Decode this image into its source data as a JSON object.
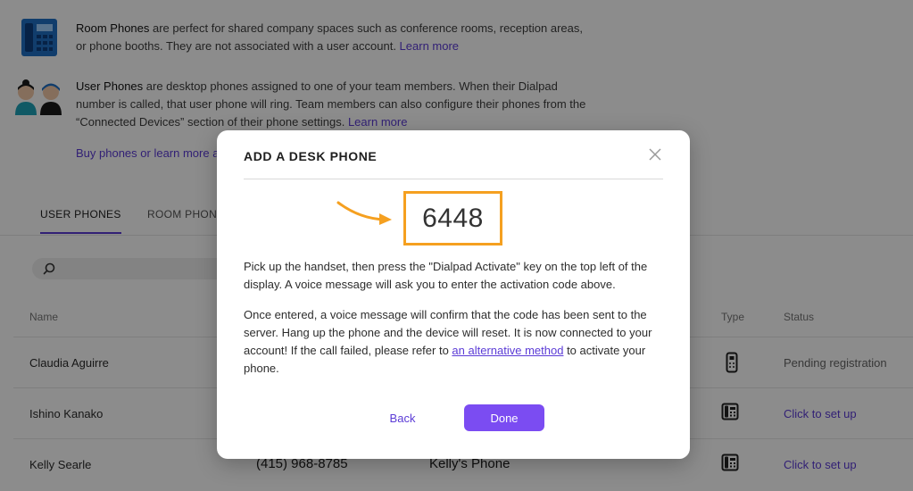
{
  "info": {
    "room_phones": {
      "title": "Room Phones",
      "text": " are perfect for shared company spaces such as conference rooms, reception areas, or phone booths. They are not associated with a user account. ",
      "link": "Learn more"
    },
    "user_phones": {
      "title": "User Phones",
      "text": " are desktop phones assigned to one of your team members. When their Dialpad number is called, that user phone will ring. Team members can also configure their phones from the “Connected Devices” section of their phone settings. ",
      "link": "Learn more"
    },
    "buy_link": "Buy phones or learn more al"
  },
  "tabs": [
    {
      "label": "USER PHONES",
      "active": true
    },
    {
      "label": "ROOM PHONE",
      "active": false
    }
  ],
  "table": {
    "headers": {
      "name": "Name",
      "type": "Type",
      "status": "Status"
    },
    "rows": [
      {
        "name": "Claudia Aguirre",
        "number": "",
        "device": "",
        "type_icon": "mobile-phone-icon",
        "status": "Pending registration"
      },
      {
        "name": "Ishino Kanako",
        "number": "",
        "device": "",
        "type_icon": "desk-phone-icon",
        "status": "Click to set up"
      },
      {
        "name": "Kelly Searle",
        "number": "(415) 968-8785",
        "device": "Kelly's Phone",
        "type_icon": "desk-phone-icon",
        "status": "Click to set up"
      }
    ]
  },
  "modal": {
    "title": "ADD A DESK PHONE",
    "code": "6448",
    "para1": "Pick up the handset, then press the \"Dialpad Activate\" key on the top left of the display. A voice message will ask you to enter the activation code above.",
    "para2_before": "Once entered, a voice message will confirm that the code has been sent to the server. Hang up the phone and the device will reset. It is now connected to your account! If the call failed, please refer to ",
    "para2_link": "an alternative method",
    "para2_after": " to activate your phone.",
    "back_label": "Back",
    "done_label": "Done"
  },
  "colors": {
    "accent": "#7b4cf2",
    "link": "#5b3bd6",
    "highlight": "#f5a020"
  }
}
